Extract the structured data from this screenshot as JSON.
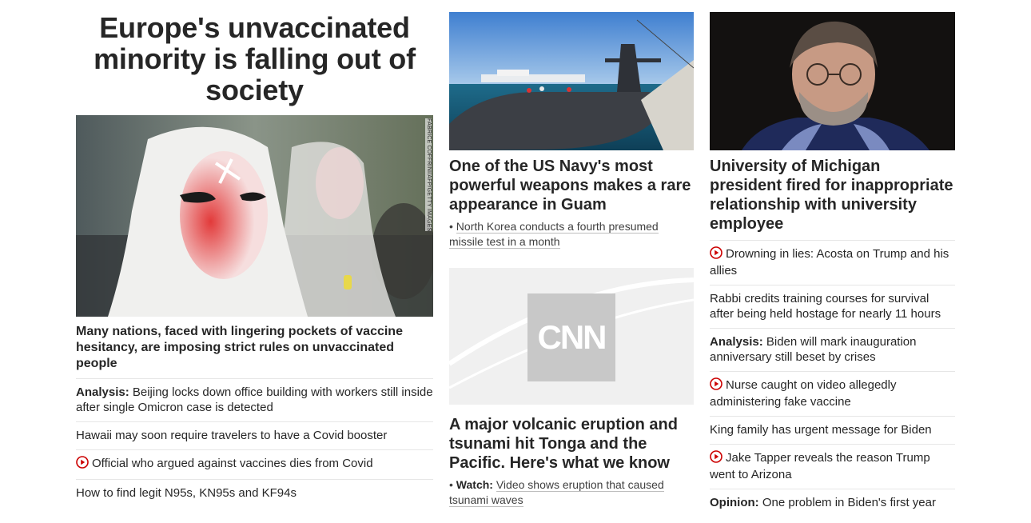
{
  "col1": {
    "headline": "Europe's unvaccinated minority is falling out of society",
    "photo_credit": "FABRICE COFFRINI/AFP/GETTY IMAGES",
    "lead_caption": "Many nations, faced with lingering pockets of vaccine hesitancy, are imposing strict rules on unvaccinated people",
    "items": [
      {
        "prefix": "Analysis:",
        "text": "Beijing locks down office building with workers still inside after single Omicron case is detected",
        "video": false
      },
      {
        "prefix": "",
        "text": "Hawaii may soon require travelers to have a Covid booster",
        "video": false
      },
      {
        "prefix": "",
        "text": "Official who argued against vaccines dies from Covid",
        "video": true
      },
      {
        "prefix": "",
        "text": "How to find legit N95s, KN95s and KF94s",
        "video": false
      }
    ]
  },
  "col2": {
    "story1": {
      "headline": "One of the US Navy's most powerful weapons makes a rare appearance in Guam",
      "sub_bullet": "•",
      "sub_text": "North Korea conducts a fourth presumed missile test in a month"
    },
    "story2": {
      "logo_text": "CNN",
      "headline": "A major volcanic eruption and tsunami hit Tonga and the Pacific. Here's what we know",
      "sub_bullet": "•",
      "sub_prefix": "Watch:",
      "sub_text": "Video shows eruption that caused tsunami waves"
    }
  },
  "col3": {
    "headline": "University of Michigan president fired for inappropriate relationship with university employee",
    "items": [
      {
        "prefix": "",
        "text": "Drowning in lies: Acosta on Trump and his allies",
        "video": true
      },
      {
        "prefix": "",
        "text": "Rabbi credits training courses for survival after being held hostage for nearly 11 hours",
        "video": false
      },
      {
        "prefix": "Analysis:",
        "text": "Biden will mark inauguration anniversary still beset by crises",
        "video": false
      },
      {
        "prefix": "",
        "text": "Nurse caught on video allegedly administering fake vaccine",
        "video": true
      },
      {
        "prefix": "",
        "text": "King family has urgent message for Biden",
        "video": false
      },
      {
        "prefix": "",
        "text": "Jake Tapper reveals the reason Trump went to Arizona",
        "video": true
      },
      {
        "prefix": "Opinion:",
        "text": "One problem in Biden's first year",
        "video": false
      }
    ]
  },
  "colors": {
    "text": "#262626",
    "divider": "#e6e6e6",
    "video_red": "#cc0000"
  },
  "icons": {
    "video": "play-circle-icon"
  }
}
